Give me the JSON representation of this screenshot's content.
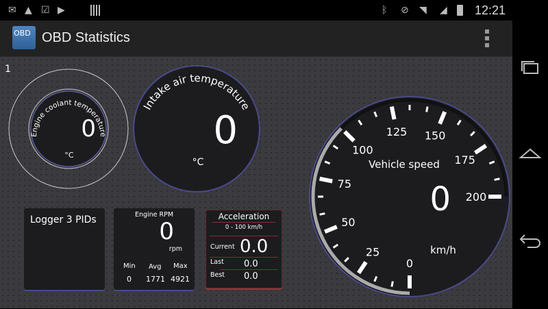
{
  "status": {
    "time": "12:21",
    "notif_icons": [
      "gmail-icon",
      "navigation-icon",
      "clipboard-check-icon",
      "clipboard-play-icon",
      "barcode-icon"
    ],
    "sys_icons": [
      "bluetooth-icon",
      "mute-icon",
      "wifi-icon",
      "signal-icon",
      "battery-charging-icon"
    ]
  },
  "appbar": {
    "logo_text": "OBD",
    "title": "OBD Statistics"
  },
  "page_number": "1",
  "coolant": {
    "label": "Engine coolant temperature",
    "value": "0",
    "unit": "°C"
  },
  "intake": {
    "label": "Intake air temperature",
    "value": "0",
    "unit": "°C"
  },
  "logger": {
    "title": "Logger 3 PIDs"
  },
  "rpm": {
    "title": "Engine RPM",
    "value": "0",
    "unit": "rpm",
    "min_label": "Min",
    "avg_label": "Avg",
    "max_label": "Max",
    "min": "0",
    "avg": "1771",
    "max": "4921"
  },
  "accel": {
    "title": "Acceleration",
    "range": "0 - 100 km/h",
    "current_label": "Current",
    "current": "0.0",
    "last_label": "Last",
    "last": "0.0",
    "best_label": "Best",
    "best": "0.0"
  },
  "speed": {
    "label": "Vehicle speed",
    "value": "0",
    "unit": "km/h",
    "min": 0,
    "max": 200,
    "major_step": 25,
    "scale_labels": [
      "0",
      "25",
      "50",
      "75",
      "100",
      "125",
      "150",
      "175",
      "200"
    ],
    "highlight_to": 100,
    "accent": "#ffffff"
  }
}
